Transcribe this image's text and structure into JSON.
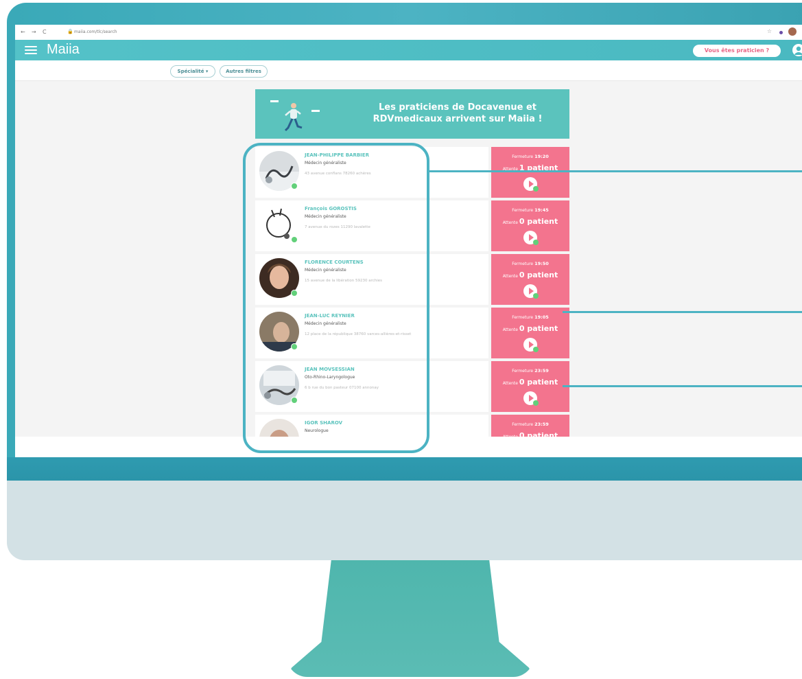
{
  "browser": {
    "url": "maiia.com/tlc/search"
  },
  "header": {
    "brand": "Maiia",
    "pro_button_label": "Vous êtes praticien ?"
  },
  "filters": {
    "specialty_label": "Spécialité ▾",
    "other_label": "Autres filtres"
  },
  "banner": {
    "line1": "Les praticiens de Docavenue et",
    "line2": "RDVmedicaux arrivent sur Maiia !"
  },
  "labels": {
    "closing": "Fermeture",
    "waiting": "Attente"
  },
  "doctors": [
    {
      "name": "JEAN-PHILIPPE BARBIER",
      "specialty": "Médecin généraliste",
      "address": "43 avenue conflans 78260 achères",
      "closing_time": "19:20",
      "waiting": "1 patient"
    },
    {
      "name": "François GOROSTIS",
      "specialty": "Médecin généraliste",
      "address": "7 avenue du rozes 11290 lavalette",
      "closing_time": "19:45",
      "waiting": "0 patient"
    },
    {
      "name": "FLORENCE COURTENS",
      "specialty": "Médecin généraliste",
      "address": "15 avenue de la libération 59230 archies",
      "closing_time": "19:50",
      "waiting": "0 patient"
    },
    {
      "name": "JEAN-LUC REYNIER",
      "specialty": "Médecin généraliste",
      "address": "12 place de la république 38760 varces-allières-et-risset",
      "closing_time": "19:05",
      "waiting": "0 patient"
    },
    {
      "name": "JEAN MOVSESSIAN",
      "specialty": "Oto-Rhino-Laryngologue",
      "address": "6 b rue du bon pasteur 07100 annonay",
      "closing_time": "23:59",
      "waiting": "0 patient"
    },
    {
      "name": "IGOR SHAROV",
      "specialty": "Neurologue",
      "address": "",
      "closing_time": "23:59",
      "waiting": "0 patient"
    }
  ],
  "colors": {
    "brand_teal": "#54c2c8",
    "status_pink": "#f3748e",
    "online_green": "#62d07a"
  }
}
